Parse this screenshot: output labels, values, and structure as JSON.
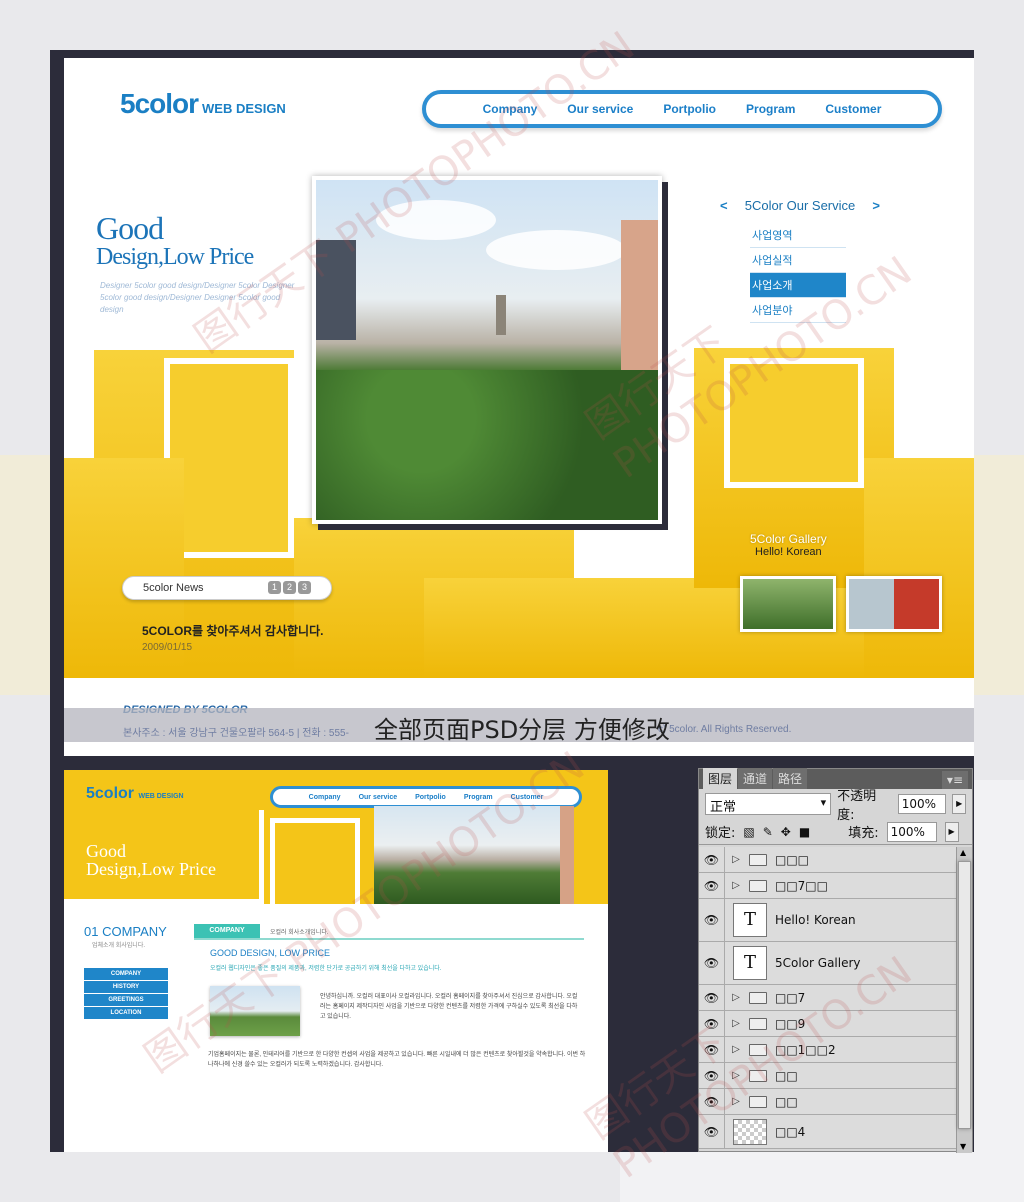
{
  "site": {
    "logo_big": "5color",
    "logo_small": "WEB DESIGN",
    "nav": [
      "Company",
      "Our service",
      "Portpolio",
      "Program",
      "Customer"
    ],
    "slogan_line1": "Good",
    "slogan_line2": "Design,Low Price",
    "slogan_sub": "Designer 5color good design/Designer 5color Designer 5color good design/Designer Designer 5color good design",
    "service": {
      "title": "5Color Our Service",
      "prev": "<",
      "next": ">",
      "items": [
        "사업영역",
        "사업실적",
        "사업소개",
        "사업분야"
      ]
    },
    "gallery": {
      "title": "5Color Gallery",
      "subtitle": "Hello! Korean"
    },
    "news": {
      "label": "5color News",
      "pages": [
        "1",
        "2",
        "3"
      ],
      "headline": "5COLOR를 찾아주셔서 감사합니다.",
      "date": "2009/01/15"
    },
    "footer": {
      "designed_by": "DESIGNED BY 5COLOR",
      "address": "본사주소 : 서울 강남구 건물오팔라 564-5  |  전화 : 555-",
      "rights": "c) 5color. All Rights Reserved."
    },
    "overlay_text": "全部页面PSD分层 方便修改"
  },
  "subpage": {
    "logo_big": "5color",
    "logo_small": "WEB DESIGN",
    "nav": [
      "Company",
      "Our service",
      "Portpolio",
      "Program",
      "Customer"
    ],
    "slogan_line1": "Good",
    "slogan_line2": "Design,Low Price",
    "section_title": "01 COMPANY",
    "section_sub": "업체소개 회사입니다.",
    "menu": [
      "COMPANY",
      "HISTORY",
      "GREETINGS",
      "LOCATION"
    ],
    "tab": "COMPANY",
    "tab_note": "오컬러 회사소개입니다.",
    "heading": "GOOD DESIGN, LOW PRICE",
    "heading_sub": "오컬러 웹디자인은 좋은 품질의 제품과, 저렴한 단가로 공급하기 위해 최선을 다하고 있습니다.",
    "para1": "안녕하십니까. 오컬러 대표이사 오컬라입니다. 오컬러 홈페이지를 찾아주셔서 진심으로 감사합니다. 오컬러는 홈페이지 제작디자인 사업을 기반으로 다양한 컨텐츠를 저렴한 가격에 구하실수 있도록 최선을 다하고 있습니다.",
    "para2": "기업홈페이지는 물론, 인테리어를 기반으로 한 다양한 컨셉의 사업을 제공하고 있습니다. 빠른 시일내에 더 많은 컨텐츠로 찾아뵐것을 약속합니다. 이번 하나하나에 신경 쓸수 있는 오컬러가 되도록 노력하겠습니다. 감사합니다."
  },
  "layers_panel": {
    "tabs": [
      "图层",
      "通道",
      "路径"
    ],
    "blend_mode": "正常",
    "opacity_label": "不透明度:",
    "opacity_value": "100%",
    "lock_label": "锁定:",
    "fill_label": "填充:",
    "fill_value": "100%",
    "layers": [
      {
        "name": "□□□",
        "type": "folder"
      },
      {
        "name": "□□7□□",
        "type": "folder"
      },
      {
        "name": "Hello! Korean",
        "type": "text"
      },
      {
        "name": "5Color Gallery",
        "type": "text"
      },
      {
        "name": "□□7",
        "type": "folder"
      },
      {
        "name": "□□9",
        "type": "folder"
      },
      {
        "name": "□□1□□2",
        "type": "folder"
      },
      {
        "name": "□□",
        "type": "folder"
      },
      {
        "name": "□□",
        "type": "folder"
      },
      {
        "name": "□□4",
        "type": "image"
      }
    ]
  },
  "watermark": "图行天下 PHOTOPHOTO.CN",
  "colors": {
    "brand_blue": "#1a7fc4",
    "accent_yellow": "#f5c312",
    "teal": "#3cc2b4",
    "dark_frame": "#2c2c3a"
  }
}
